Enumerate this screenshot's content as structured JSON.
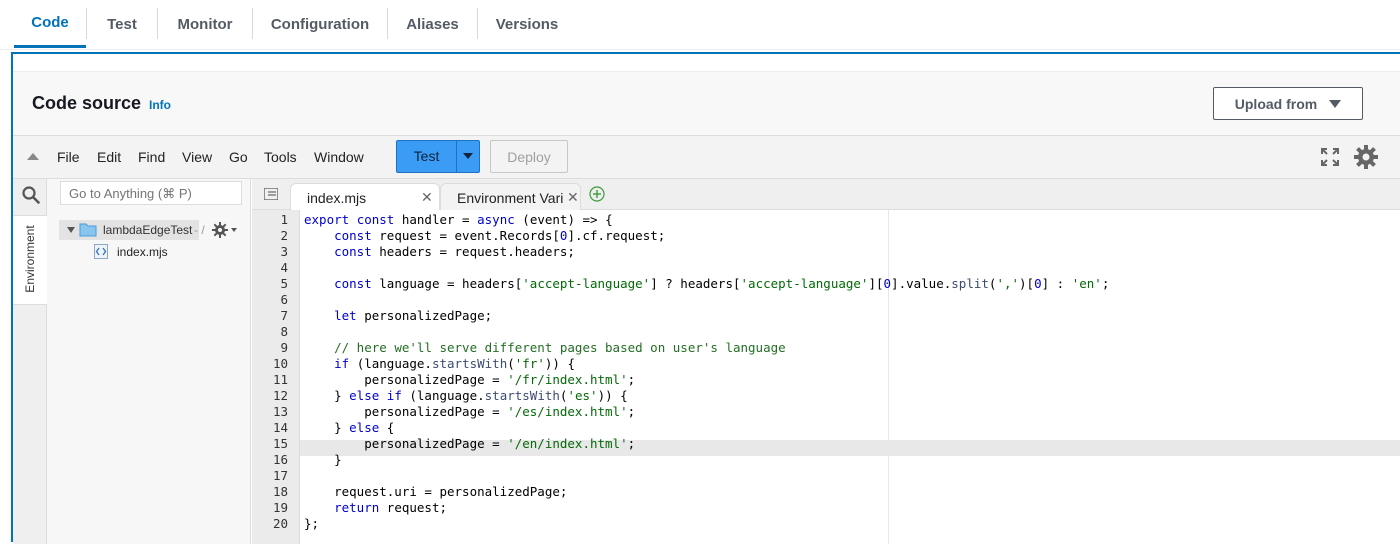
{
  "tabs": [
    "Code",
    "Test",
    "Monitor",
    "Configuration",
    "Aliases",
    "Versions"
  ],
  "header": {
    "title": "Code source",
    "info": "Info",
    "upload_label": "Upload from"
  },
  "menubar": {
    "items": [
      "File",
      "Edit",
      "Find",
      "View",
      "Go",
      "Tools",
      "Window"
    ],
    "test_label": "Test",
    "deploy_label": "Deploy"
  },
  "sidebar": {
    "search_placeholder": "Go to Anything (⌘ P)",
    "environment_label": "Environment",
    "folder_name": "lambdaEdgeTest",
    "folder_suffix": "- /",
    "file_name": "index.mjs"
  },
  "editor_tabs": [
    {
      "label": "index.mjs",
      "active": true
    },
    {
      "label": "Environment Vari",
      "active": false
    }
  ],
  "editor": {
    "active_line": 15,
    "line_numbers": [
      "1",
      "2",
      "3",
      "4",
      "5",
      "6",
      "7",
      "8",
      "9",
      "10",
      "11",
      "12",
      "13",
      "14",
      "15",
      "16",
      "17",
      "18",
      "19",
      "20"
    ],
    "lines": [
      "export const handler = async (event) => {",
      "    const request = event.Records[0].cf.request;",
      "    const headers = request.headers;",
      "",
      "    const language = headers['accept-language'] ? headers['accept-language'][0].value.split(',')[0] : 'en';",
      "",
      "    let personalizedPage;",
      "",
      "    // here we'll serve different pages based on user's language",
      "    if (language.startsWith('fr')) {",
      "        personalizedPage = '/fr/index.html';",
      "    } else if (language.startsWith('es')) {",
      "        personalizedPage = '/es/index.html';",
      "    } else {",
      "        personalizedPage = '/en/index.html';",
      "    }",
      "",
      "    request.uri = personalizedPage;",
      "    return request;",
      "};"
    ]
  },
  "colors": {
    "accent": "#0073bb",
    "test_button": "#3b9cf5",
    "keyword": "#0000cc",
    "string": "#036a07",
    "comment": "#236e24"
  }
}
